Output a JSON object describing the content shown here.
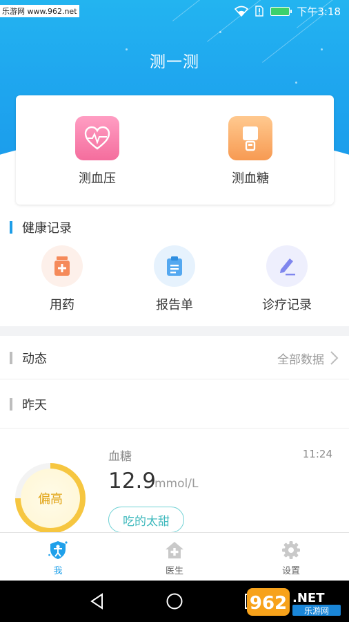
{
  "status_bar": {
    "watermark": "乐游网 www.962.net",
    "time": "下午3:18",
    "battery_color": "#3cd16b"
  },
  "header": {
    "title": "测一测",
    "accent": "#1fa7ef"
  },
  "measure": [
    {
      "label": "测血压",
      "icon": "heart-pulse-icon"
    },
    {
      "label": "测血糖",
      "icon": "glucose-meter-icon"
    }
  ],
  "health_records": {
    "title": "健康记录",
    "accent": "#1e9ee8",
    "items": [
      {
        "label": "用药",
        "icon": "medicine-box-icon",
        "color": "#f58a5a"
      },
      {
        "label": "报告单",
        "icon": "clipboard-icon",
        "color": "#54a8f0"
      },
      {
        "label": "诊疗记录",
        "icon": "pen-edit-icon",
        "color": "#7f86ee"
      }
    ]
  },
  "feed": {
    "title": "动态",
    "more_label": "全部数据"
  },
  "day": {
    "label": "昨天"
  },
  "record": {
    "type": "血糖",
    "time": "11:24",
    "value": "12.9",
    "unit": "mmol/L",
    "status": "偏高",
    "status_ratio": 0.75,
    "tag": "吃的太甜"
  },
  "tabs": [
    {
      "label": "我",
      "icon": "shield-person-icon",
      "active": true
    },
    {
      "label": "医生",
      "icon": "house-cross-icon",
      "active": false
    },
    {
      "label": "设置",
      "icon": "gear-icon",
      "active": false
    }
  ],
  "colors": {
    "active_tab": "#1fa0ea",
    "inactive_tab": "#666666",
    "ring": "#f6c640",
    "tag": "#3fb9bd"
  },
  "branding": {
    "site_logo": "962.NET",
    "site_logo_sub": "乐游网"
  }
}
